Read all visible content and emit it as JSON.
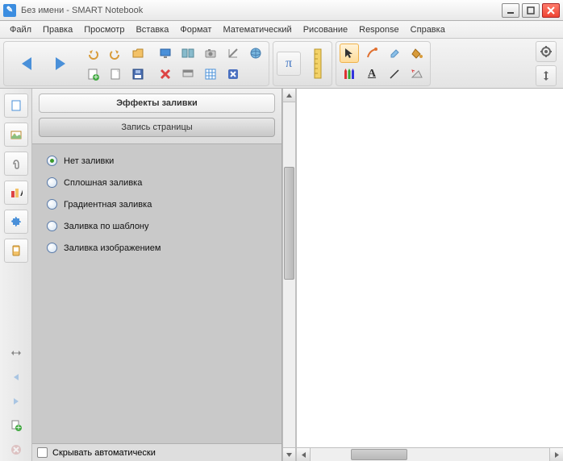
{
  "window": {
    "title": "Без имени - SMART Notebook"
  },
  "menu": {
    "items": [
      "Файл",
      "Правка",
      "Просмотр",
      "Вставка",
      "Формат",
      "Математический",
      "Рисование",
      "Response",
      "Справка"
    ]
  },
  "toolbar": {
    "nav_back": "←",
    "nav_forward": "→",
    "icons": {
      "undo": "undo",
      "redo": "redo",
      "folder": "folder",
      "add_page": "add-page",
      "new_file": "new-file",
      "save": "save",
      "monitor": "monitor",
      "dual_page": "dual-page",
      "camera": "camera",
      "shapes_tool": "shapes",
      "delete": "delete",
      "screen_shade": "screen-shade",
      "table": "table",
      "globe": "globe",
      "cancel": "cancel"
    },
    "math_pi": "π",
    "ruler": "ruler",
    "select": "pointer",
    "magic": "magic",
    "eraser": "eraser",
    "fill": "fill",
    "pens": "pens",
    "text": "A",
    "line": "line",
    "erase_bulk": "bulk-eraser",
    "settings": "gear",
    "move": "move"
  },
  "sidebar_tabs": {
    "page": "page",
    "gallery": "gallery",
    "attachment": "clip",
    "properties": "properties",
    "addons": "puzzle",
    "activity": "tablet"
  },
  "vstrip_controls": {
    "collapse": "↔",
    "back": "←",
    "forward": "→",
    "add": "+",
    "delete_page": "×"
  },
  "panel": {
    "title": "Эффекты заливки",
    "subtitle": "Запись страницы",
    "fill_options": [
      {
        "label": "Нет заливки",
        "checked": true
      },
      {
        "label": "Сплошная заливка",
        "checked": false
      },
      {
        "label": "Градиентная заливка",
        "checked": false
      },
      {
        "label": "Заливка по шаблону",
        "checked": false
      },
      {
        "label": "Заливка изображением",
        "checked": false
      }
    ],
    "autohide": "Скрывать автоматически"
  },
  "colors": {
    "accent_orange": "#f0b24a",
    "blue": "#3b8de0",
    "green_dot": "#3a9a2a"
  }
}
